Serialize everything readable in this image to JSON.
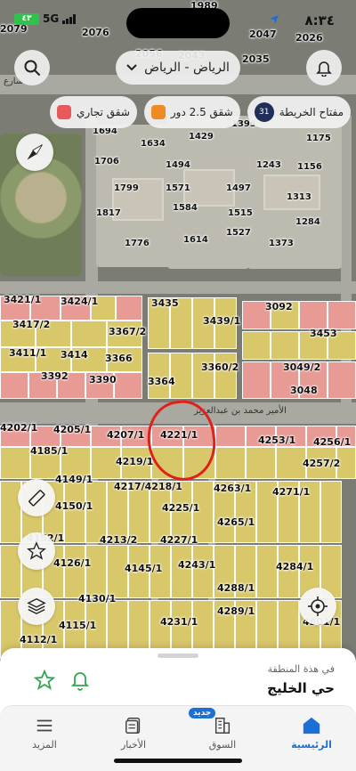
{
  "status_bar": {
    "time": "٨:٣٤",
    "network": "5G",
    "battery": "٤٣"
  },
  "header": {
    "city_selector": "الرياض - الرياض"
  },
  "legend": {
    "items": [
      {
        "label": "مفتاح الخريطة",
        "badge": "31",
        "color": "#1f2f57"
      },
      {
        "label": "شقق 2.5 دور",
        "color": "#f08a24"
      },
      {
        "label": "شقق تجاري",
        "color": "#e8595b"
      }
    ]
  },
  "map": {
    "street_label": "الأمير محمد بن عبدالعزيز",
    "street_label_top": "شارع",
    "plot_labels_top": [
      "1989",
      "2076",
      "2047",
      "2026",
      "2079",
      "2056",
      "2043",
      "2035",
      "1694",
      "1634",
      "1429",
      "1393",
      "1175",
      "1706",
      "1494",
      "1243",
      "1156",
      "1799",
      "1571",
      "1497",
      "1313",
      "1817",
      "1584",
      "1515",
      "1284",
      "1776",
      "1614",
      "1527",
      "1373"
    ],
    "plot_labels_mid": [
      "3421/1",
      "3424/1",
      "3435",
      "3092",
      "3417/2",
      "3367/2",
      "3439/1",
      "3453",
      "3411/1",
      "3414",
      "3366",
      "3360/2",
      "3049/2",
      "3392",
      "3390",
      "3364",
      "3048"
    ],
    "plot_labels_bottom": [
      "4202/1",
      "4205/1",
      "4207/1",
      "4221/1",
      "4253/1",
      "4256/1",
      "4185/1",
      "4219/1",
      "4257/2",
      "4149/1",
      "4217/4218/1",
      "4263/1",
      "4271/1",
      "4150/1",
      "4225/1",
      "4265/1",
      "4152/1",
      "4213/2",
      "4227/1",
      "4126/1",
      "4145/1",
      "4243/1",
      "4284/1",
      "4130/1",
      "4288/1",
      "4115/1",
      "4231/1",
      "4289/1",
      "4112/1",
      "4301/1"
    ],
    "highlighted_plot": "4221/1",
    "annotation_color": "#e0201a"
  },
  "area_panel": {
    "caption": "في هذة المنطقة",
    "name": "حي الخليج"
  },
  "tabs": [
    {
      "label": "الرئيسية",
      "icon": "home-icon",
      "active": true
    },
    {
      "label": "السوق",
      "icon": "market-icon",
      "badge": "جديد",
      "active": false
    },
    {
      "label": "الأخبار",
      "icon": "news-icon",
      "active": false
    },
    {
      "label": "المزيد",
      "icon": "menu-icon",
      "active": false
    }
  ],
  "colors": {
    "accent": "#1d6fd8",
    "yellow_plot": "#d9c86a",
    "pink_plot": "#e89a94",
    "notification_green": "#2fa84f"
  }
}
